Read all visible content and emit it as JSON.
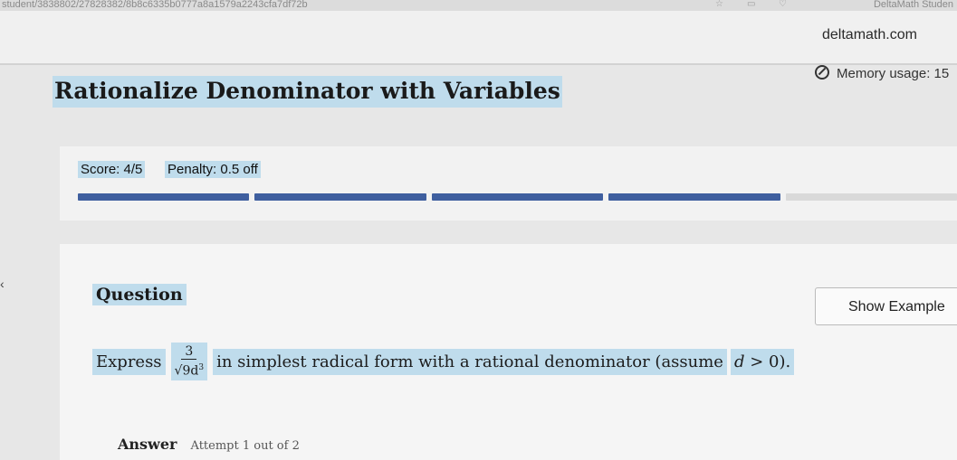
{
  "browser": {
    "tab_url_text": "student/3838802/27828382/8b8c6335b0777a8a1579a2243cfa7df72b",
    "app_name": "DeltaMath Studen",
    "domain": "deltamath.com",
    "memory_usage": "Memory usage: 15"
  },
  "page": {
    "title": "Rationalize Denominator with Variables"
  },
  "score": {
    "score_label": "Score: 4/5",
    "penalty_label": "Penalty: 0.5 off",
    "progress_completed": 4,
    "progress_total": 5
  },
  "question": {
    "label": "Question",
    "show_example_label": "Show Example",
    "prompt_prefix": "Express",
    "fraction_numerator": "3",
    "fraction_denominator_base": "9d",
    "fraction_denominator_exp": "3",
    "prompt_suffix": "in simplest radical form with a rational denominator (assume",
    "cond_var": "d",
    "cond_rest": "> 0)."
  },
  "answer": {
    "label": "Answer",
    "attempt_text": "Attempt 1 out of 2"
  },
  "colors": {
    "highlight": "#bfdcec",
    "progress_fill": "#3f5f9f",
    "progress_empty": "#d9d9d9"
  }
}
